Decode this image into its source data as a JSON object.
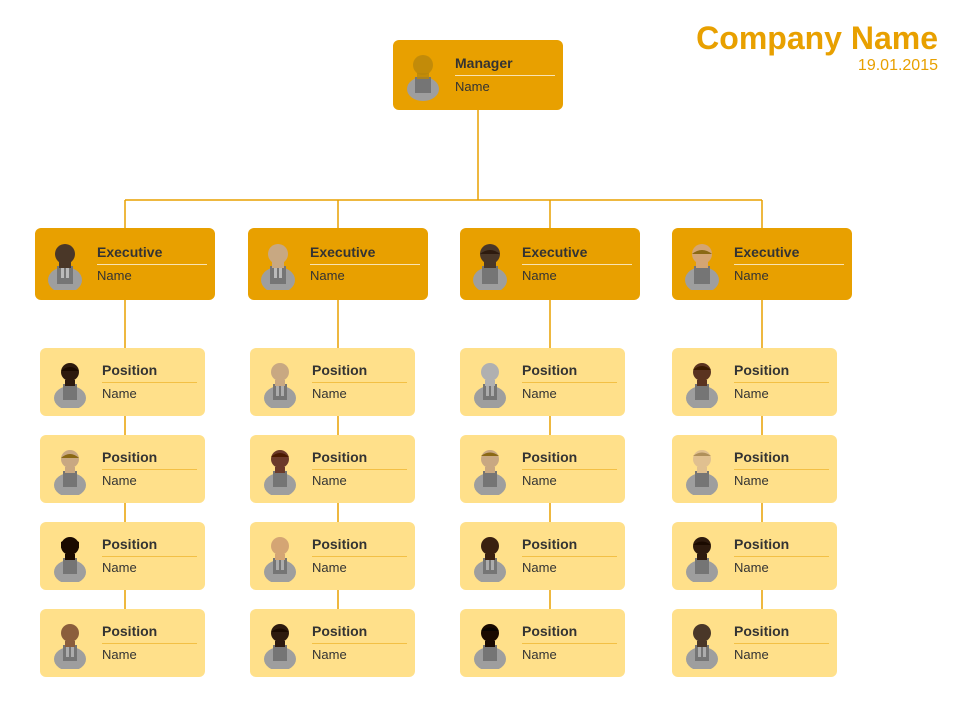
{
  "company": {
    "name": "Company Name",
    "date": "19.01.2015"
  },
  "manager": {
    "title": "Manager",
    "name": "Name"
  },
  "executives": [
    {
      "title": "Executive",
      "name": "Name",
      "avatarType": "male-dark"
    },
    {
      "title": "Executive",
      "name": "Name",
      "avatarType": "male-light"
    },
    {
      "title": "Executive",
      "name": "Name",
      "avatarType": "female-dark"
    },
    {
      "title": "Executive",
      "name": "Name",
      "avatarType": "female-light"
    }
  ],
  "positions": [
    [
      {
        "title": "Position",
        "name": "Name",
        "avatarType": "female-dark"
      },
      {
        "title": "Position",
        "name": "Name",
        "avatarType": "female-light"
      },
      {
        "title": "Position",
        "name": "Name",
        "avatarType": "female-dark2"
      },
      {
        "title": "Position",
        "name": "Name",
        "avatarType": "male-brown"
      }
    ],
    [
      {
        "title": "Position",
        "name": "Name",
        "avatarType": "male-light2"
      },
      {
        "title": "Position",
        "name": "Name",
        "avatarType": "female-brown"
      },
      {
        "title": "Position",
        "name": "Name",
        "avatarType": "male-light"
      },
      {
        "title": "Position",
        "name": "Name",
        "avatarType": "female-dark"
      }
    ],
    [
      {
        "title": "Position",
        "name": "Name",
        "avatarType": "male-light3"
      },
      {
        "title": "Position",
        "name": "Name",
        "avatarType": "female-light2"
      },
      {
        "title": "Position",
        "name": "Name",
        "avatarType": "male-dark2"
      },
      {
        "title": "Position",
        "name": "Name",
        "avatarType": "female-dark3"
      }
    ],
    [
      {
        "title": "Position",
        "name": "Name",
        "avatarType": "female-brown2"
      },
      {
        "title": "Position",
        "name": "Name",
        "avatarType": "female-light3"
      },
      {
        "title": "Position",
        "name": "Name",
        "avatarType": "female-dark4"
      },
      {
        "title": "Position",
        "name": "Name",
        "avatarType": "male-dark3"
      }
    ]
  ]
}
